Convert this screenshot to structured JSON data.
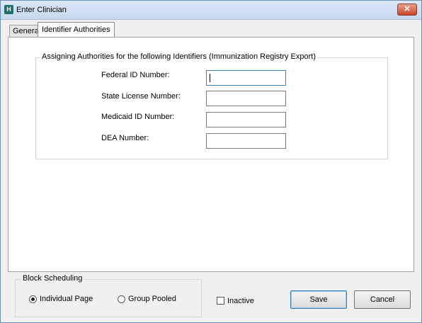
{
  "window": {
    "title": "Enter Clinician"
  },
  "tabs": [
    {
      "label": "General"
    },
    {
      "label": "Identifier Authorities"
    }
  ],
  "group": {
    "title": "Assigning Authorities for the following Identifiers (Immunization Registry Export)",
    "fields": [
      {
        "label": "Federal ID Number:",
        "value": ""
      },
      {
        "label": "State License Number:",
        "value": ""
      },
      {
        "label": "Medicaid ID Number:",
        "value": ""
      },
      {
        "label": "DEA Number:",
        "value": ""
      }
    ]
  },
  "block_scheduling": {
    "title": "Block Scheduling",
    "options": [
      {
        "label": "Individual Page",
        "selected": true
      },
      {
        "label": "Group Pooled",
        "selected": false
      }
    ]
  },
  "inactive": {
    "label": "Inactive",
    "checked": false
  },
  "buttons": {
    "save": "Save",
    "cancel": "Cancel"
  }
}
